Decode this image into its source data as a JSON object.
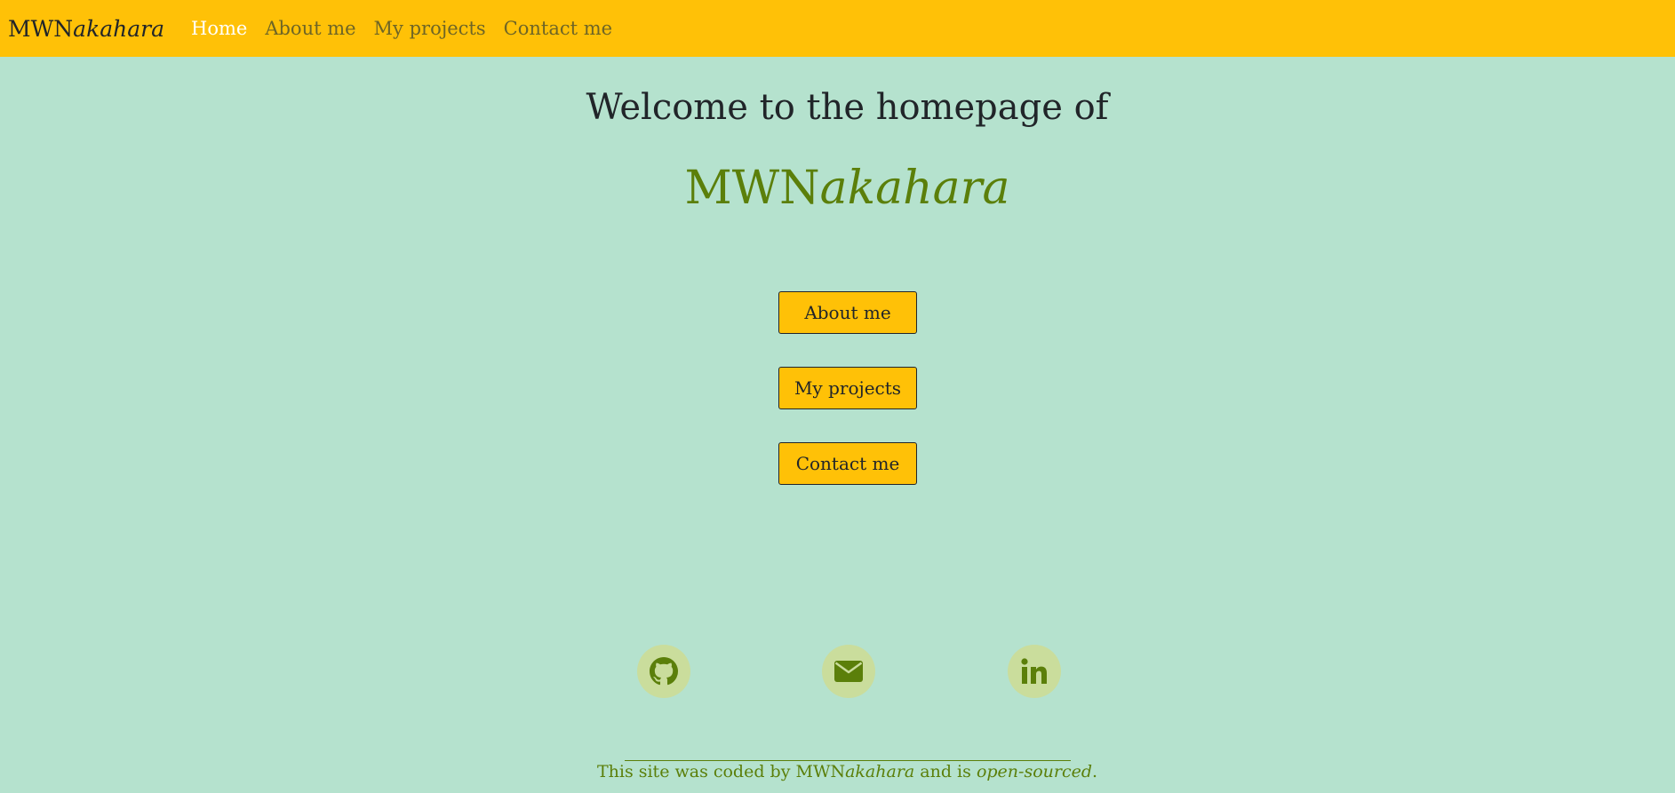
{
  "navbar": {
    "brand_plain": "MWN",
    "brand_italic": "akahara",
    "links": [
      {
        "label": "Home",
        "active": true
      },
      {
        "label": "About me",
        "active": false
      },
      {
        "label": "My projects",
        "active": false
      },
      {
        "label": "Contact me",
        "active": false
      }
    ]
  },
  "hero": {
    "welcome": "Welcome to the homepage of",
    "name_plain": "MWN",
    "name_italic": "akahara"
  },
  "buttons": {
    "about": "About me",
    "projects": "My projects",
    "contact": "Contact me"
  },
  "social": {
    "github_icon": "github-icon",
    "email_icon": "envelope-icon",
    "linkedin_icon": "linkedin-icon"
  },
  "footer": {
    "prefix": "This site was coded by ",
    "author_plain": "MWN",
    "author_italic": "akahara",
    "middle": " and is ",
    "open_sourced": "open-sourced",
    "suffix": "."
  },
  "colors": {
    "navbar_bg": "#ffc107",
    "page_bg": "#b5e2ce",
    "accent_green": "#5b7f0a",
    "social_circle": "#cadd9c",
    "active_link": "#ffffff"
  }
}
